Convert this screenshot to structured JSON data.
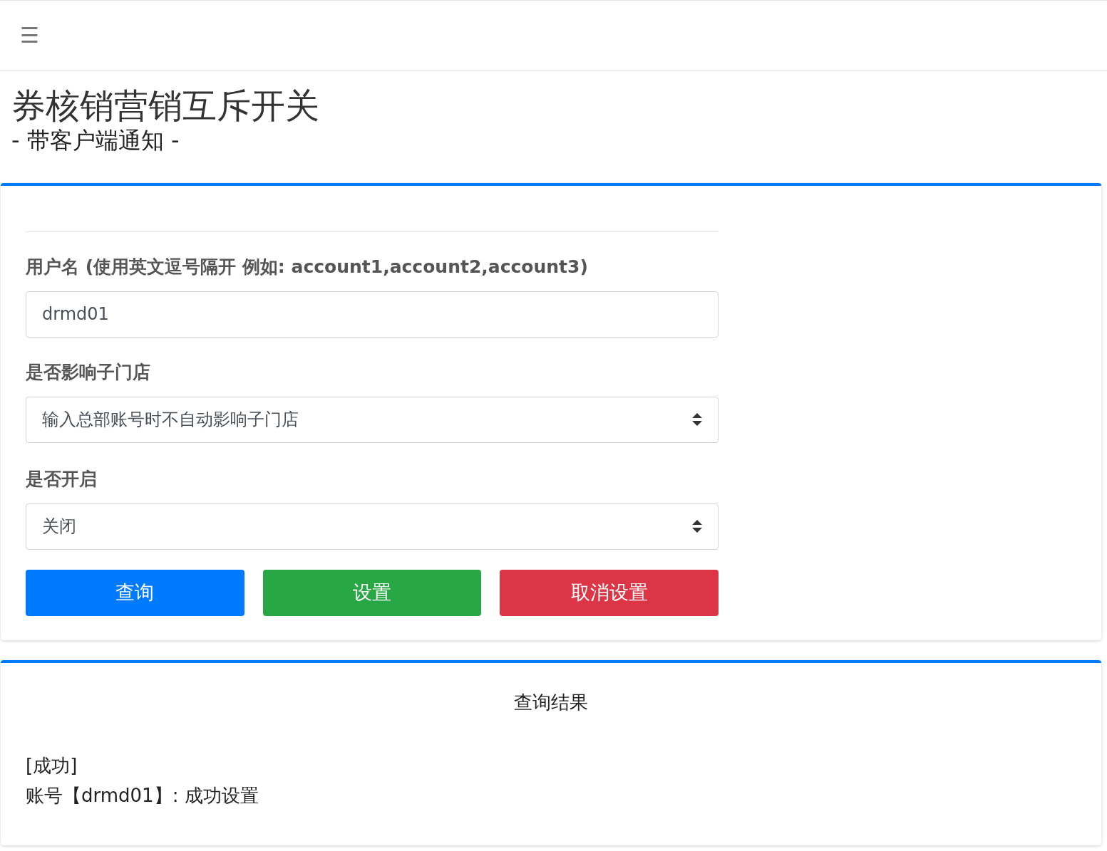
{
  "topbar": {
    "menu_icon": "☰"
  },
  "header": {
    "title": "券核销营销互斥开关",
    "subtitle": "- 带客户端通知 -"
  },
  "form": {
    "fields": [
      {
        "kind": "input",
        "label": "用户名 (使用英文逗号隔开 例如: account1,account2,account3)",
        "value": "drmd01"
      },
      {
        "kind": "select",
        "label": "是否影响子门店",
        "value": "输入总部账号时不自动影响子门店"
      },
      {
        "kind": "select",
        "label": "是否开启",
        "value": "关闭"
      }
    ],
    "buttons": [
      {
        "label": "查询",
        "kind": "primary"
      },
      {
        "label": "设置",
        "kind": "success"
      },
      {
        "label": "取消设置",
        "kind": "danger"
      }
    ]
  },
  "result": {
    "title": "查询结果",
    "lines": [
      "[成功]",
      "账号【drmd01】: 成功设置"
    ]
  }
}
